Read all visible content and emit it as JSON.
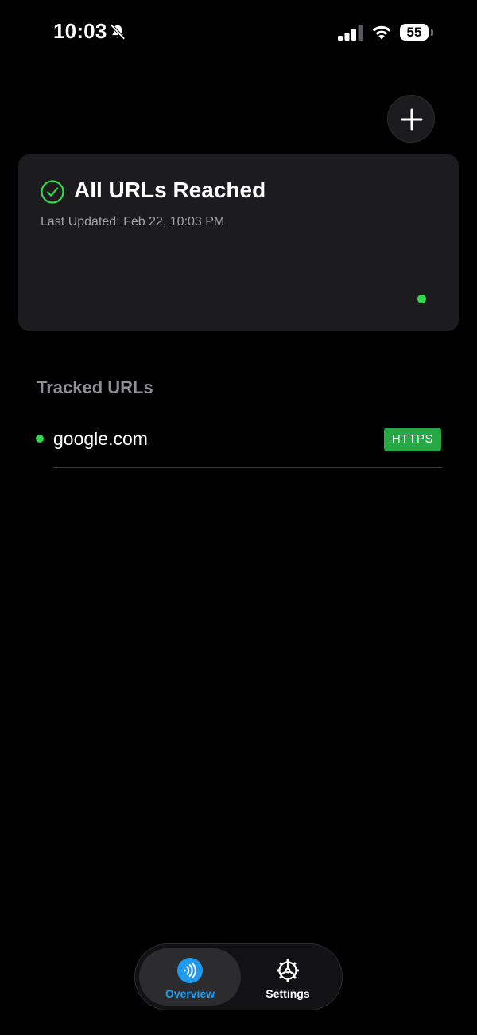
{
  "status_bar": {
    "time": "10:03",
    "battery": "55",
    "icons": [
      "bell-slash-icon",
      "cellular-signal-icon",
      "wifi-icon",
      "battery-icon"
    ]
  },
  "header": {
    "add_icon": "plus-icon"
  },
  "status_card": {
    "icon": "checkmark-circle-icon",
    "title": "All URLs Reached",
    "last_updated": "Last Updated: Feb 22, 10:03 PM",
    "indicator_color": "#32d74b"
  },
  "tracked": {
    "heading": "Tracked URLs",
    "items": [
      {
        "url": "google.com",
        "protocol": "HTTPS",
        "status_color": "#32d74b"
      }
    ]
  },
  "tab_bar": {
    "tabs": [
      {
        "label": "Overview",
        "icon": "signal-waves-icon",
        "selected": true
      },
      {
        "label": "Settings",
        "icon": "gear-icon",
        "selected": false
      }
    ]
  },
  "colors": {
    "accent": "#1e9bf0",
    "success": "#32d74b",
    "badge": "#27a844",
    "card": "#1c1c1e",
    "background": "#000000"
  }
}
